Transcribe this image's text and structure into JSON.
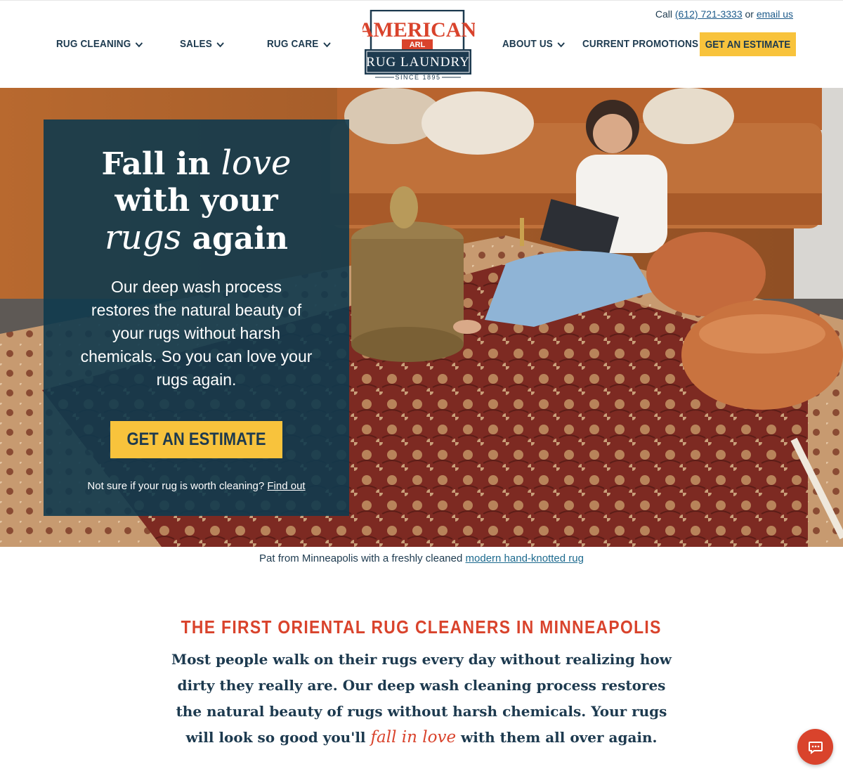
{
  "header": {
    "contact": {
      "prefix": "Call",
      "phone": "(612) 721-3333",
      "separator": "or",
      "email": "email us"
    },
    "nav_left": [
      {
        "label": "RUG CLEANING"
      },
      {
        "label": "SALES"
      },
      {
        "label": "RUG CARE"
      }
    ],
    "nav_right": [
      {
        "label": "ABOUT US"
      },
      {
        "label": "CURRENT PROMOTIONS"
      }
    ],
    "cta_label": "GET AN ESTIMATE",
    "logo": {
      "line1": "AMERICAN",
      "monogram": "ARL",
      "line2": "RUG LAUNDRY",
      "line3": "SINCE 1895"
    }
  },
  "hero": {
    "title_1": "Fall in",
    "title_script_1": "love",
    "title_2": "with your",
    "title_script_2": "rugs",
    "title_3": "again",
    "body": "Our deep wash process restores the natural beauty of your rugs without harsh chemicals. So you can love your rugs again.",
    "cta_label": "GET AN ESTIMATE",
    "note_text": "Not sure if your rug is worth cleaning?",
    "note_link": "Find out"
  },
  "caption": {
    "text": "Pat from Minneapolis with a freshly cleaned",
    "link": "modern hand-knotted rug"
  },
  "intro": {
    "heading": "THE FIRST ORIENTAL RUG CLEANERS IN MINNEAPOLIS",
    "body_1": "Most people walk on their rugs every day without realizing how dirty they really are. Our deep wash cleaning process restores the natural beauty of rugs without harsh chemicals. Your rugs will look so good you'll",
    "body_love": "fall in love",
    "body_2": "with them all over again."
  },
  "colors": {
    "navy": "#1d3a4f",
    "accent_yellow": "#f8c33c",
    "accent_red": "#d9432c",
    "hero_panel": "#0f3a4e"
  },
  "icons": {
    "chevron": "chevron-down-icon",
    "chat": "chat-bubble-icon"
  }
}
